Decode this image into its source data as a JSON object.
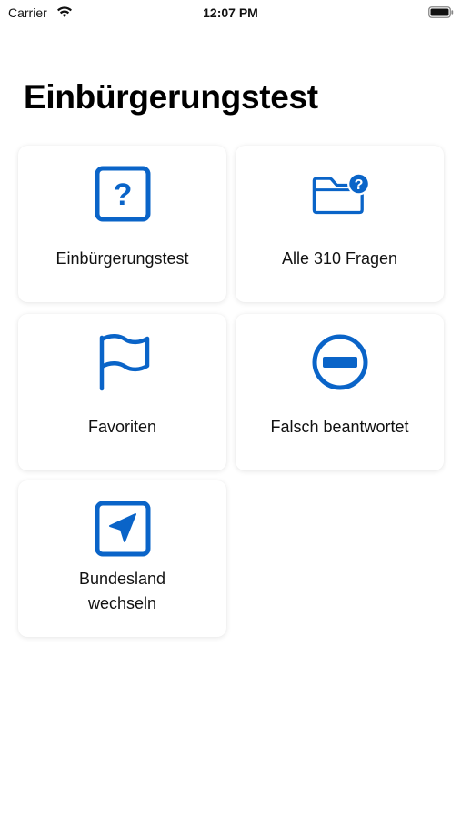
{
  "status_bar": {
    "carrier": "Carrier",
    "time": "12:07 PM",
    "wifi_icon": "wifi-icon",
    "battery_icon": "battery-icon"
  },
  "title": "Einbürgerungstest",
  "accent_color": "#0A64C8",
  "tiles": [
    {
      "label": "Einbürgerungstest",
      "icon": "question-square-icon"
    },
    {
      "label": "Alle 310 Fragen",
      "icon": "folder-question-icon"
    },
    {
      "label": "Favoriten",
      "icon": "flag-icon"
    },
    {
      "label": "Falsch beantwortet",
      "icon": "minus-circle-icon"
    },
    {
      "label": "Bundesland\nwechseln",
      "icon": "location-arrow-square-icon"
    }
  ]
}
